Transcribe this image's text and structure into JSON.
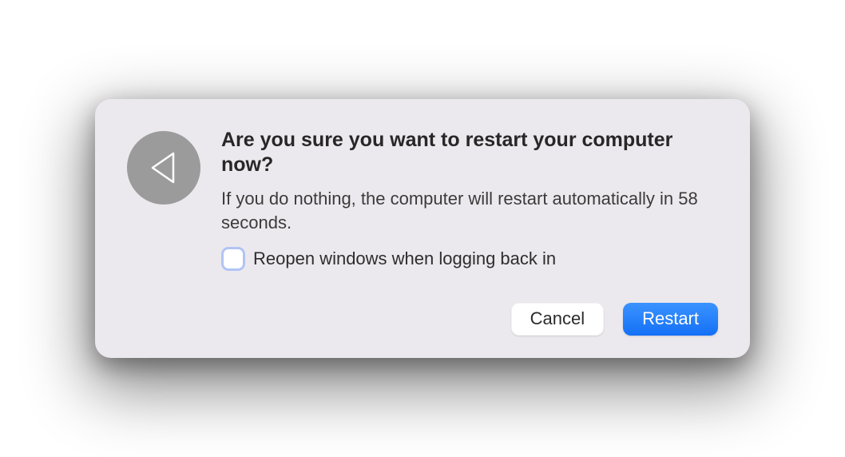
{
  "dialog": {
    "title": "Are you sure you want to restart your computer now?",
    "message": "If you do nothing, the computer will restart automatically in 58 seconds.",
    "checkbox_label": "Reopen windows when logging back in",
    "checkbox_checked": false,
    "icon": "restart-triangle-icon",
    "buttons": {
      "cancel": "Cancel",
      "restart": "Restart"
    }
  }
}
